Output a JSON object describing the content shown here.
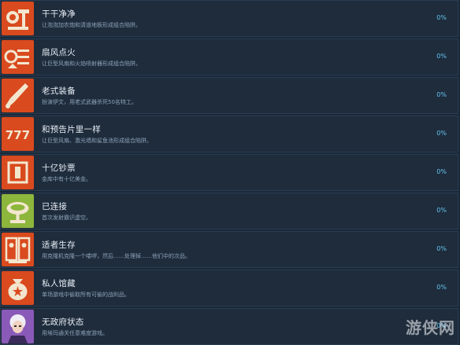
{
  "achievements": [
    {
      "title": "干干净净",
      "desc": "让泡泡加农炮和清道地板形成组合陷阱。",
      "pct": "0%",
      "icon": "cleaning-icon"
    },
    {
      "title": "扇风点火",
      "desc": "让巨型风扇和火焰喷射器形成组合陷阱。",
      "pct": "0%",
      "icon": "fan-fire-icon"
    },
    {
      "title": "老式装备",
      "desc": "扮演伊文，用老式武器杀死50名特工。",
      "pct": "0%",
      "icon": "rocket-icon"
    },
    {
      "title": "和预告片里一样",
      "desc": "让巨型风扇、激光墙和鲨鱼池形成组合陷阱。",
      "pct": "0%",
      "icon": "slot-777-icon"
    },
    {
      "title": "十亿钞票",
      "desc": "金库中有十亿美金。",
      "pct": "0%",
      "icon": "banknote-icon"
    },
    {
      "title": "已连接",
      "desc": "首次发射霸识虚空。",
      "pct": "0%",
      "icon": "satellite-dish-icon"
    },
    {
      "title": "适者生存",
      "desc": "用克隆机克隆一个喽啰，然后……处理掉……他们中的次品。",
      "pct": "0%",
      "icon": "clone-machine-icon"
    },
    {
      "title": "私人馆藏",
      "desc": "单场游戏中偷取所有可偷的战利品。",
      "pct": "0%",
      "icon": "money-bag-icon"
    },
    {
      "title": "无政府状态",
      "desc": "用埃玛通关任意难度游戏。",
      "pct": "0%",
      "icon": "villain-portrait-icon"
    }
  ],
  "watermark": "游侠网",
  "colors": {
    "background": "#1b2838",
    "row": "#1e2c3c",
    "percent": "#65c4f0",
    "icon_orange": "#d94a1e",
    "icon_green": "#8db63c"
  }
}
